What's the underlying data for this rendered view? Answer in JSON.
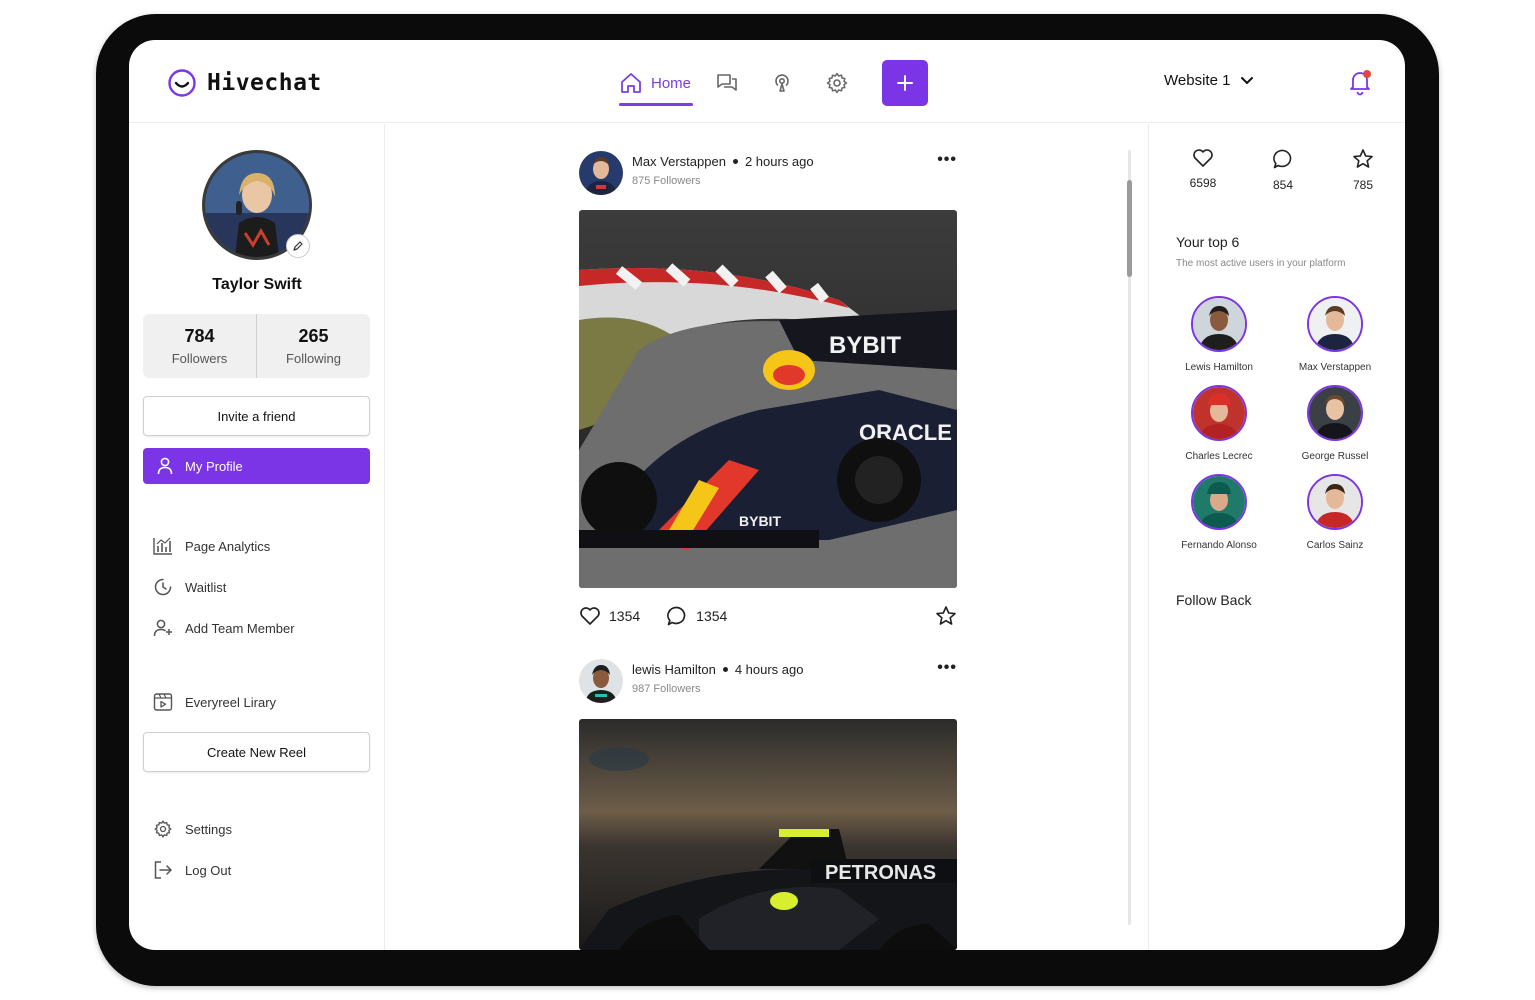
{
  "app": {
    "name": "Hivechat"
  },
  "nav": {
    "home_label": "Home",
    "items": [
      {
        "icon": "home-icon",
        "label": "Home",
        "active": true
      },
      {
        "icon": "chat-icon"
      },
      {
        "icon": "broadcast-icon"
      },
      {
        "icon": "gear-icon"
      },
      {
        "icon": "plus-icon"
      }
    ],
    "site_selector": "Website 1"
  },
  "colors": {
    "accent": "#7b35e6",
    "notification_dot": "#e0483e"
  },
  "profile": {
    "name": "Taylor Swift",
    "followers_count": "784",
    "followers_label": "Followers",
    "following_count": "265",
    "following_label": "Following",
    "invite_label": "Invite a friend"
  },
  "sidebar": {
    "items": [
      {
        "label": "My Profile",
        "icon": "user-icon",
        "active": true
      },
      {
        "label": "Page Analytics",
        "icon": "analytics-icon"
      },
      {
        "label": "Waitlist",
        "icon": "clock-icon"
      },
      {
        "label": "Add Team Member",
        "icon": "user-plus-icon"
      },
      {
        "label": "Everyreel Lirary",
        "icon": "video-library-icon"
      }
    ],
    "create_reel_label": "Create New Reel",
    "settings_label": "Settings",
    "logout_label": "Log Out"
  },
  "posts": [
    {
      "author": "Max Verstappen",
      "time": "2 hours ago",
      "followers": "875 Followers",
      "likes": "1354",
      "comments": "1354"
    },
    {
      "author": "lewis Hamilton",
      "time": "4 hours ago",
      "followers": "987 Followers"
    }
  ],
  "right_panel": {
    "stats": [
      {
        "icon": "heart-icon",
        "value": "6598"
      },
      {
        "icon": "comment-icon",
        "value": "854"
      },
      {
        "icon": "star-icon",
        "value": "785"
      }
    ],
    "top_title": "Your top 6",
    "top_subtitle": "The most active users in your platform",
    "top_users": [
      {
        "name": "Lewis Hamilton"
      },
      {
        "name": "Max Verstappen"
      },
      {
        "name": "Charles Lecrec"
      },
      {
        "name": "George Russel"
      },
      {
        "name": "Fernando Alonso"
      },
      {
        "name": "Carlos Sainz"
      }
    ],
    "follow_back_label": "Follow Back"
  }
}
